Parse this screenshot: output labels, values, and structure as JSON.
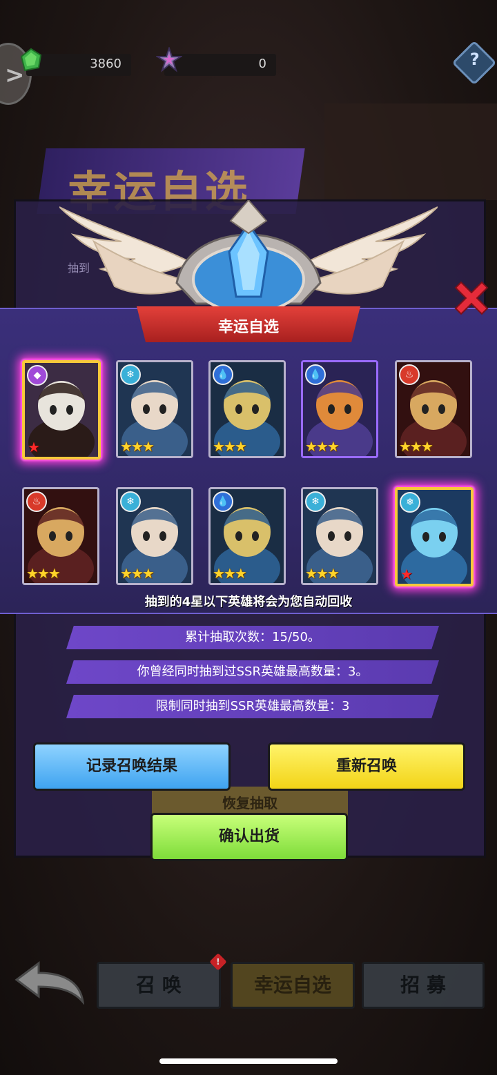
{
  "resources": [
    {
      "icon": "green-gem-icon",
      "value": "3860"
    },
    {
      "icon": "star-crystal-icon",
      "value": "0"
    }
  ],
  "background_panel": {
    "title": "幸运自选",
    "strip_text": "抽到",
    "restore_label": "恢复抽取"
  },
  "modal": {
    "title": "幸运自选",
    "notice": "抽到的4星以下英雄将会为您自动回收"
  },
  "heroes": [
    {
      "element": "purple-symbol-icon",
      "element_color": "#a04ad8",
      "stars": "★",
      "star_type": "red",
      "highlight": true,
      "palette": [
        "#2a1b18",
        "#e8e4dc",
        "#3c2c44"
      ]
    },
    {
      "element": "snowflake-icon",
      "element_color": "#3ab0d8",
      "stars": "★★★",
      "star_type": "gold",
      "highlight": false,
      "palette": [
        "#3a5f8a",
        "#e8d8c8",
        "#1f3552"
      ]
    },
    {
      "element": "water-drop-icon",
      "element_color": "#2f6fd8",
      "stars": "★★★",
      "star_type": "gold",
      "highlight": false,
      "palette": [
        "#2b5c8c",
        "#d9c06a",
        "#1a2d44"
      ]
    },
    {
      "element": "water-drop-icon",
      "element_color": "#2f6fd8",
      "stars": "★★★",
      "star_type": "gold",
      "highlight": false,
      "palette": [
        "#4a3a8a",
        "#e08a3a",
        "#2a2355"
      ]
    },
    {
      "element": "fire-icon",
      "element_color": "#d83a2a",
      "stars": "★★★",
      "star_type": "gold",
      "highlight": false,
      "palette": [
        "#5a2020",
        "#d8a860",
        "#321010"
      ]
    },
    {
      "element": "fire-icon",
      "element_color": "#d83a2a",
      "stars": "★★★",
      "star_type": "gold",
      "highlight": false,
      "palette": [
        "#5a2020",
        "#d8a860",
        "#321010"
      ]
    },
    {
      "element": "snowflake-icon",
      "element_color": "#3ab0d8",
      "stars": "★★★",
      "star_type": "gold",
      "highlight": false,
      "palette": [
        "#3a5f8a",
        "#e8d8c8",
        "#1f3552"
      ]
    },
    {
      "element": "water-drop-icon",
      "element_color": "#2f6fd8",
      "stars": "★★★",
      "star_type": "gold",
      "highlight": false,
      "palette": [
        "#2b5c8c",
        "#d9c06a",
        "#1a2d44"
      ]
    },
    {
      "element": "snowflake-icon",
      "element_color": "#3ab0d8",
      "stars": "★★★",
      "star_type": "gold",
      "highlight": false,
      "palette": [
        "#3a5f8a",
        "#e8d8c8",
        "#1f3552"
      ]
    },
    {
      "element": "snowflake-icon",
      "element_color": "#3ab0d8",
      "stars": "★",
      "star_type": "red",
      "highlight": true,
      "palette": [
        "#2d6aa0",
        "#7ad0f0",
        "#1c3a60"
      ]
    }
  ],
  "info": {
    "line1": "累计抽取次数：15/50。",
    "line2": "你曾经同时抽到过SSR英雄最高数量：3。",
    "line3": "限制同时抽到SSR英雄最高数量：3"
  },
  "buttons": {
    "record": "记录召唤结果",
    "resummon": "重新召唤",
    "confirm": "确认出货"
  },
  "nav": {
    "tabs": [
      {
        "label": "召 唤",
        "badge": "!"
      },
      {
        "label": "幸运自选",
        "badge": ""
      },
      {
        "label": "招 募",
        "badge": ""
      }
    ]
  },
  "colors": {
    "modal_bg": "#342a6c",
    "ribbon": "#d0302c",
    "info_bar": "#6445bd",
    "btn_blue": "#5ab4f3",
    "btn_yellow": "#f6dc2a",
    "btn_green": "#9aea4a"
  }
}
